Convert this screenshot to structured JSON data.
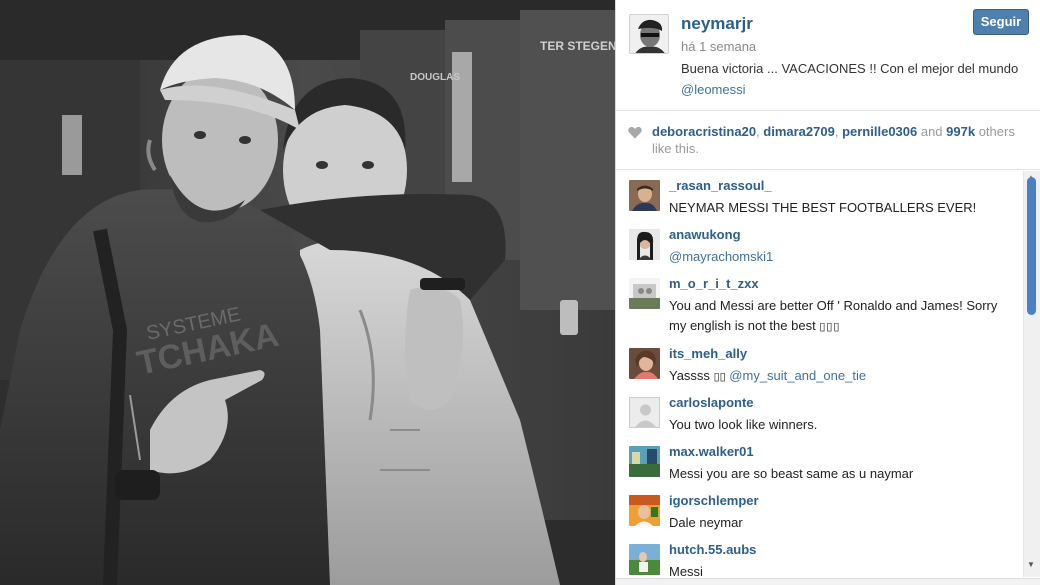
{
  "post": {
    "username": "neymarjr",
    "timestamp": "há 1 semana",
    "caption_text": "Buena victoria ... VACACIONES !! Con el mejor del mundo ",
    "caption_mention": "@leomessi",
    "follow_label": "Seguir"
  },
  "photo": {
    "locker_labels": [
      "DOUGLAS",
      "TER STEGEN",
      "SYSTEME",
      "TCHAKA"
    ]
  },
  "likes": {
    "likers": [
      "deboracristina20",
      "dimara2709",
      "pernille0306"
    ],
    "sep1": ", ",
    "sep2": ", ",
    "and_text": " and ",
    "count": "997k",
    "suffix": " others like this."
  },
  "comments": [
    {
      "user": "_rasan_rassoul_",
      "text": "NEYMAR MESSI THE BEST FOOTBALLERS EVER!",
      "mention": ""
    },
    {
      "user": "anawukong",
      "text": "",
      "mention": "@mayrachomski1"
    },
    {
      "user": "m_o_r_i_t_zxx",
      "text": "You and Messi are better Off ' Ronaldo and James! Sorry my english is not the best ",
      "mention": ""
    },
    {
      "user": "its_meh_ally",
      "text": "Yassss ",
      "mention": "@my_suit_and_one_tie"
    },
    {
      "user": "carloslaponte",
      "text": "You two look like winners.",
      "mention": ""
    },
    {
      "user": "max.walker01",
      "text": "Messi you are so beast same as u naymar",
      "mention": ""
    },
    {
      "user": "igorschlemper",
      "text": "Dale neymar",
      "mention": ""
    },
    {
      "user": "hutch.55.aubs",
      "text": "Messi",
      "mention": ""
    }
  ],
  "colors": {
    "link": "#2d5f8a",
    "follow_button": "#4f7fad",
    "scroll_thumb": "#4a80c4"
  },
  "icons": {
    "heart": "heart-icon",
    "scroll_up": "▲",
    "scroll_down": "▼"
  }
}
